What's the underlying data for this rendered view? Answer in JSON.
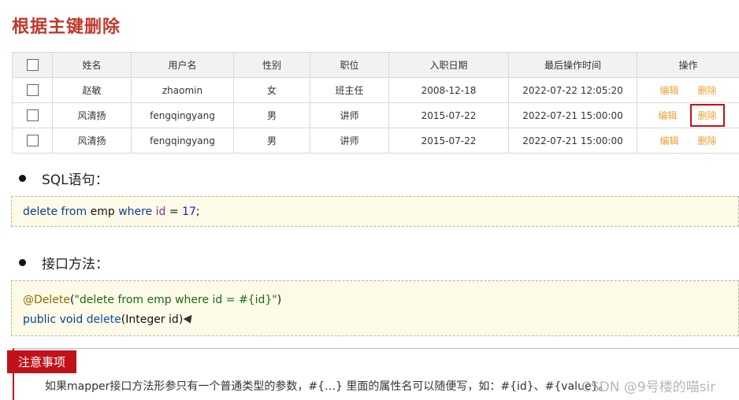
{
  "title": "根据主键删除",
  "table": {
    "headers": [
      "姓名",
      "用户名",
      "性别",
      "职位",
      "入职日期",
      "最后操作时间",
      "操作"
    ],
    "rows": [
      {
        "name": "赵敏",
        "username": "zhaomin",
        "gender": "女",
        "position": "班主任",
        "entry_date": "2008-12-18",
        "last_op": "2022-07-22 12:05:20",
        "edit": "编辑",
        "delete": "删除"
      },
      {
        "name": "风清扬",
        "username": "fengqingyang",
        "gender": "男",
        "position": "讲师",
        "entry_date": "2015-07-22",
        "last_op": "2022-07-21 15:00:00",
        "edit": "编辑",
        "delete": "删除"
      },
      {
        "name": "风清扬",
        "username": "fengqingyang",
        "gender": "男",
        "position": "讲师",
        "entry_date": "2015-07-22",
        "last_op": "2022-07-21 15:00:00",
        "edit": "编辑",
        "delete": "删除"
      }
    ]
  },
  "sections": {
    "sql_heading": "SQL语句：",
    "sql_code": {
      "kw1": "delete from",
      "table": "emp",
      "kw2": "where",
      "field": "id",
      "op": "=",
      "value": "17",
      "end": ";"
    },
    "iface_heading": "接口方法：",
    "iface_code": {
      "annotation": "@Delete",
      "open": "(",
      "string": "\"delete from emp where id = #{id}\"",
      "close": ")",
      "sig_kw": "public void",
      "sig_name": "delete",
      "sig_params": "(Integer id)"
    }
  },
  "notice": {
    "tag": "注意事项",
    "text": "如果mapper接口方法形参只有一个普通类型的参数，#{…} 里面的属性名可以随便写，如：#{id}、#{value}。"
  },
  "watermark": "CSDN @9号楼的喵sir",
  "colors": {
    "title": "#c0392b",
    "accent_red": "#c0121b",
    "link_orange": "#f0a030"
  }
}
